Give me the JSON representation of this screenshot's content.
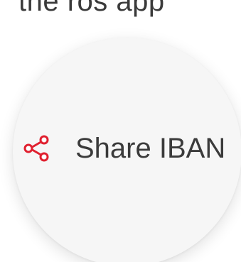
{
  "heading": {
    "fragment": "the ros app"
  },
  "share_action": {
    "label": "Share IBAN",
    "icon": "share-icon",
    "accent_color": "#e0202f"
  }
}
